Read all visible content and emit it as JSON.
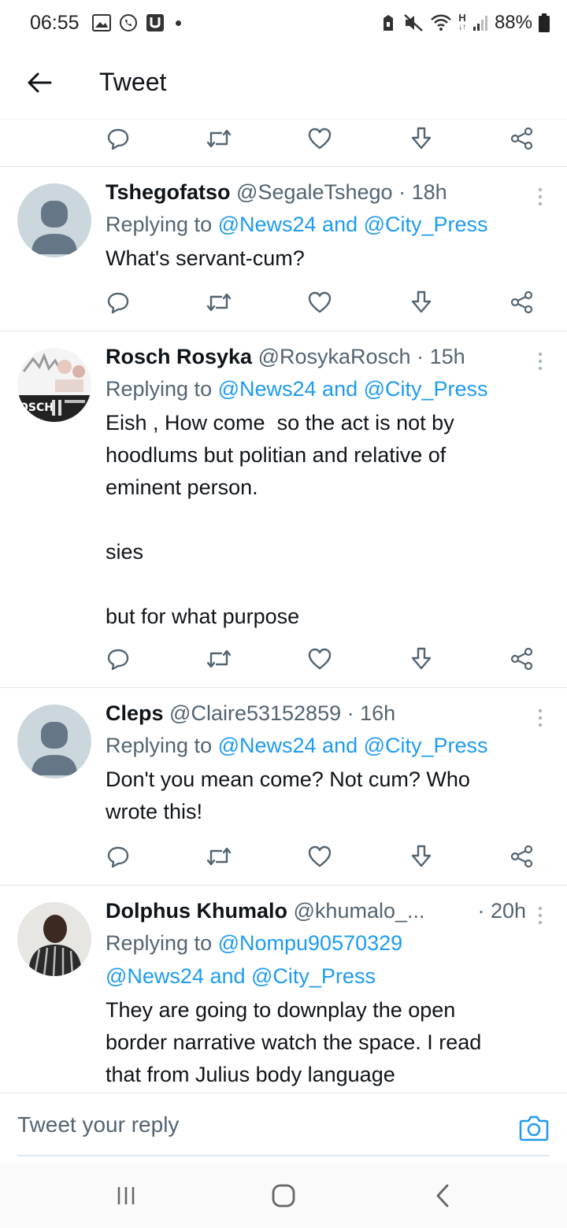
{
  "status_bar": {
    "time": "06:55",
    "battery": "88%",
    "network_label": "H"
  },
  "header": {
    "title": "Tweet"
  },
  "tweets": [
    {
      "name": "Tshegofatso",
      "handle": "@SegaleTshego",
      "time": "· 18h",
      "replying_prefix": "Replying to ",
      "replying_mentions": "@News24 and @City_Press",
      "text": "What's servant-cum?"
    },
    {
      "name": "Rosch Rosyka",
      "handle": "@RosykaRosch",
      "time": "· 15h",
      "replying_prefix": "Replying to ",
      "replying_mentions": "@News24 and @City_Press",
      "text": "Eish , How come  so the act is not by\nhoodlums but politian and relative of\neminent person.\n\nsies\n\nbut for what purpose"
    },
    {
      "name": "Cleps",
      "handle": "@Claire53152859",
      "time": "· 16h",
      "replying_prefix": "Replying to ",
      "replying_mentions": "@News24 and @City_Press",
      "text": "Don't you mean come? Not cum? Who\nwrote this!"
    },
    {
      "name": "Dolphus Khumalo",
      "handle": "@khumalo_...",
      "time": "· 20h",
      "replying_prefix": "Replying to ",
      "replying_mentions": "@Nompu90570329",
      "replying_mentions_2": "@News24 and @City_Press",
      "text": "They are going to downplay the open\nborder narrative watch the space. I read\nthat from Julius body language"
    }
  ],
  "reply_bar": {
    "placeholder": "Tweet your reply"
  },
  "colors": {
    "accent": "#1d9bf0",
    "text": "#0f1419",
    "secondary": "#536471",
    "divider": "#e1e8ed"
  },
  "icons": {
    "reply": "reply-icon",
    "retweet": "retweet-icon",
    "like": "heart-icon",
    "download": "download-icon",
    "share": "share-icon"
  }
}
